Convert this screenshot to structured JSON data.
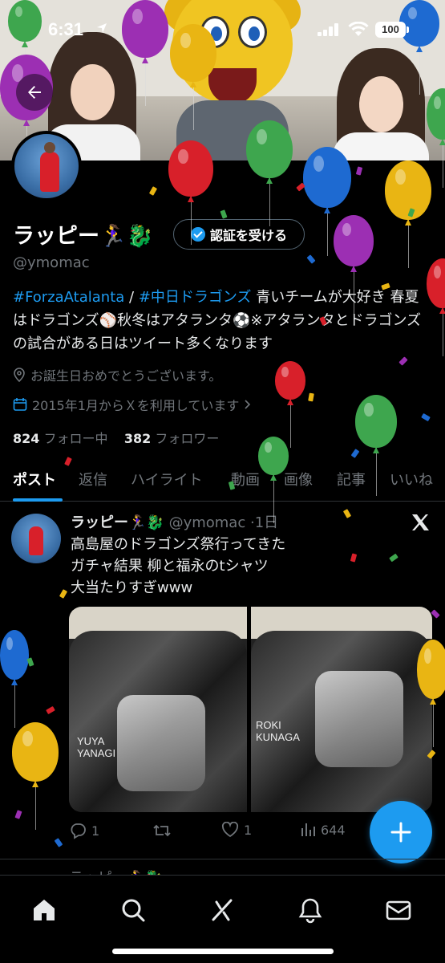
{
  "status": {
    "time": "6:31",
    "battery": "100"
  },
  "profile": {
    "display_name": "ラッピー🏃‍♀️🐉",
    "handle": "@ymomac",
    "verify_button": "認証を受ける",
    "bio_tag1": "#ForzaAtalanta",
    "bio_sep": " / ",
    "bio_tag2": "#中日ドラゴンズ",
    "bio_rest": " 青いチームが大好き 春夏はドラゴンズ⚾️秋冬はアタランタ⚽️※アタランタとドラゴンズの試合がある日はツイート多くなります",
    "birthday": "お誕生日おめでとうございます。",
    "joined": "2015年1月からＸを利用しています",
    "following_count": "824",
    "following_label": "フォロー中",
    "followers_count": "382",
    "followers_label": "フォロワー"
  },
  "tabs": [
    "ポスト",
    "返信",
    "ハイライト",
    "動画",
    "画像",
    "記事",
    "いいね"
  ],
  "post": {
    "author": "ラッピー🏃‍♀️🐉",
    "handle": "@ymomac",
    "time": "·1日",
    "text_line1": "高島屋のドラゴンズ祭行ってきた",
    "text_line2": "ガチャ結果 柳と福永のtシャツ",
    "text_line3": "大当たりすぎwww",
    "image1_text": "YUYA\nYANAGI",
    "image2_text": "ROKI\nKUNAGA",
    "replies": "1",
    "likes": "1",
    "views": "644"
  },
  "next_post": {
    "author": "ラッピー🏃‍♀️🐉"
  },
  "colors": {
    "accent": "#1d9bf0",
    "background": "#000000",
    "muted": "#71767b"
  }
}
